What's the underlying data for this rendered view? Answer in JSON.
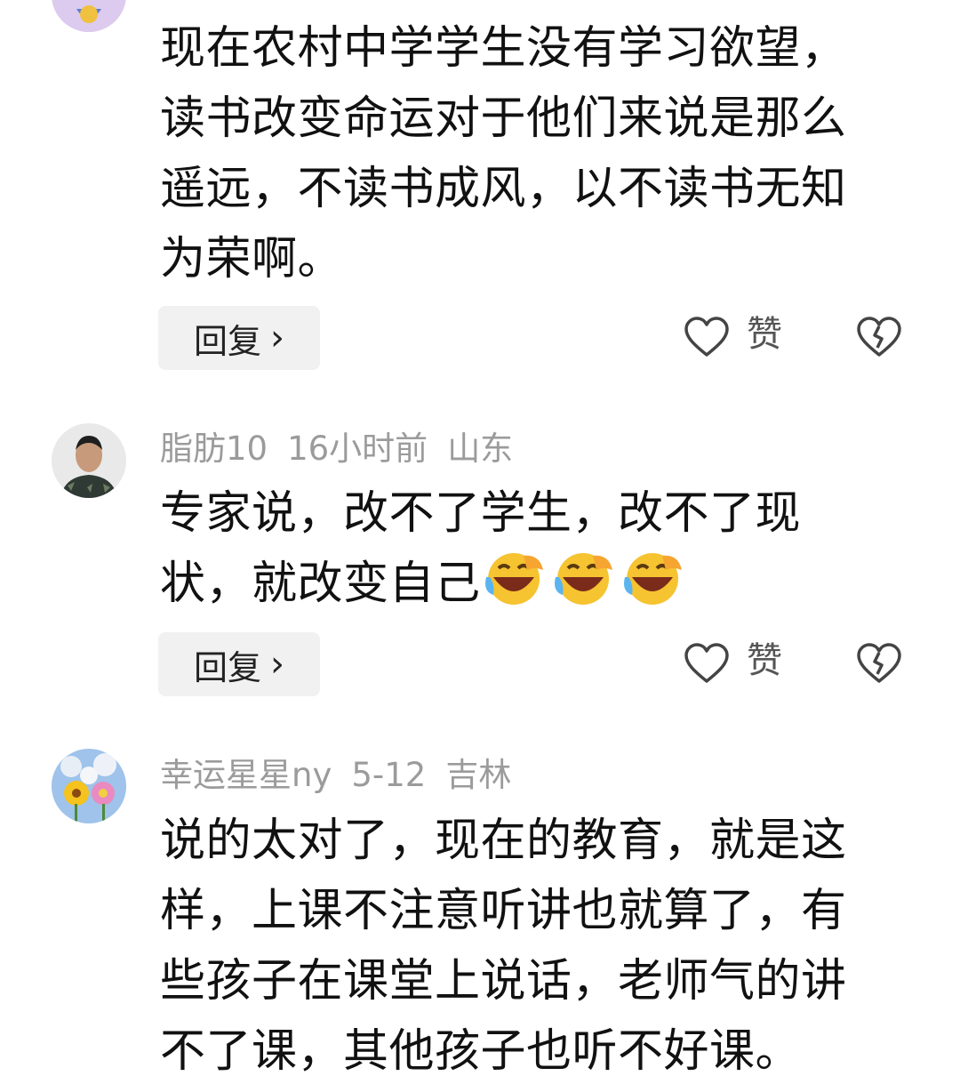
{
  "comments": [
    {
      "user": "",
      "time": "",
      "location": "",
      "text_lines": [
        "现在农村中学学生没有学习欲望，",
        "读书改变命运对于他们来说是那么",
        "遥远，不读书成风，以不读书无知",
        "为荣啊。"
      ],
      "reply_label": "回复",
      "like_label": "赞"
    },
    {
      "user": "脂肪10",
      "time": "16小时前",
      "location": "山东",
      "text_lines": [
        "专家说，改不了学生，改不了现",
        "状，就改变自己"
      ],
      "emoji": [
        "laugh-cry-emoji",
        "laugh-cry-emoji",
        "laugh-cry-emoji"
      ],
      "reply_label": "回复",
      "like_label": "赞"
    },
    {
      "user": "幸运星星ny",
      "time": "5-12",
      "location": "吉林",
      "text_lines": [
        "说的太对了，现在的教育，就是这",
        "样，上课不注意听讲也就算了，有",
        "些孩子在课堂上说话，老师气的讲",
        "不了课，其他孩子也听不好课。"
      ]
    }
  ],
  "colors": {
    "meta": "#9b9b9b",
    "text": "#111111",
    "reply_bg": "#f1f1f1"
  }
}
